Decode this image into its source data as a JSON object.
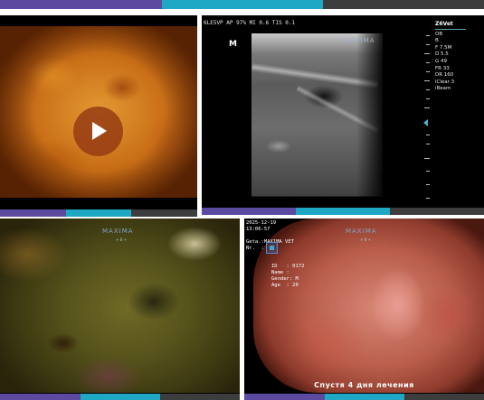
{
  "colors": {
    "stripe_purple": "#5b4aa0",
    "stripe_cyan": "#1fa8c4",
    "stripe_gray": "#3d3d3d",
    "play_button": "#963c14",
    "us_pointer": "#4ab3d1"
  },
  "video_tile": {
    "play_icon": "play-icon"
  },
  "ultrasound": {
    "header": "6LE5VP AP 97%  MI 0.6  TIS 0.1",
    "mode_marker": "M",
    "logo": "MAXIMA",
    "panel": {
      "brand": "Z6Vet",
      "lines": [
        "OB",
        "B",
        "F 7.5M",
        "D 5.5",
        "G 49",
        "FR 33",
        "DR 160",
        "iClear 3",
        "iBeam"
      ]
    }
  },
  "endoscopy_1": {
    "logo": "MAXIMA",
    "logo_sub": "+ 8 +"
  },
  "endoscopy_2": {
    "info_top": "2025-12-19\n13:06:57\n\nGeta.:MAXIMA VET\nNr.  :",
    "info_mid": "ID   : 0172\nName :\nGender: M\nAge  : 20",
    "logo": "MAXIMA",
    "logo_sub": "+ 8 +",
    "caption": "Спустя 4 дня лечения"
  }
}
